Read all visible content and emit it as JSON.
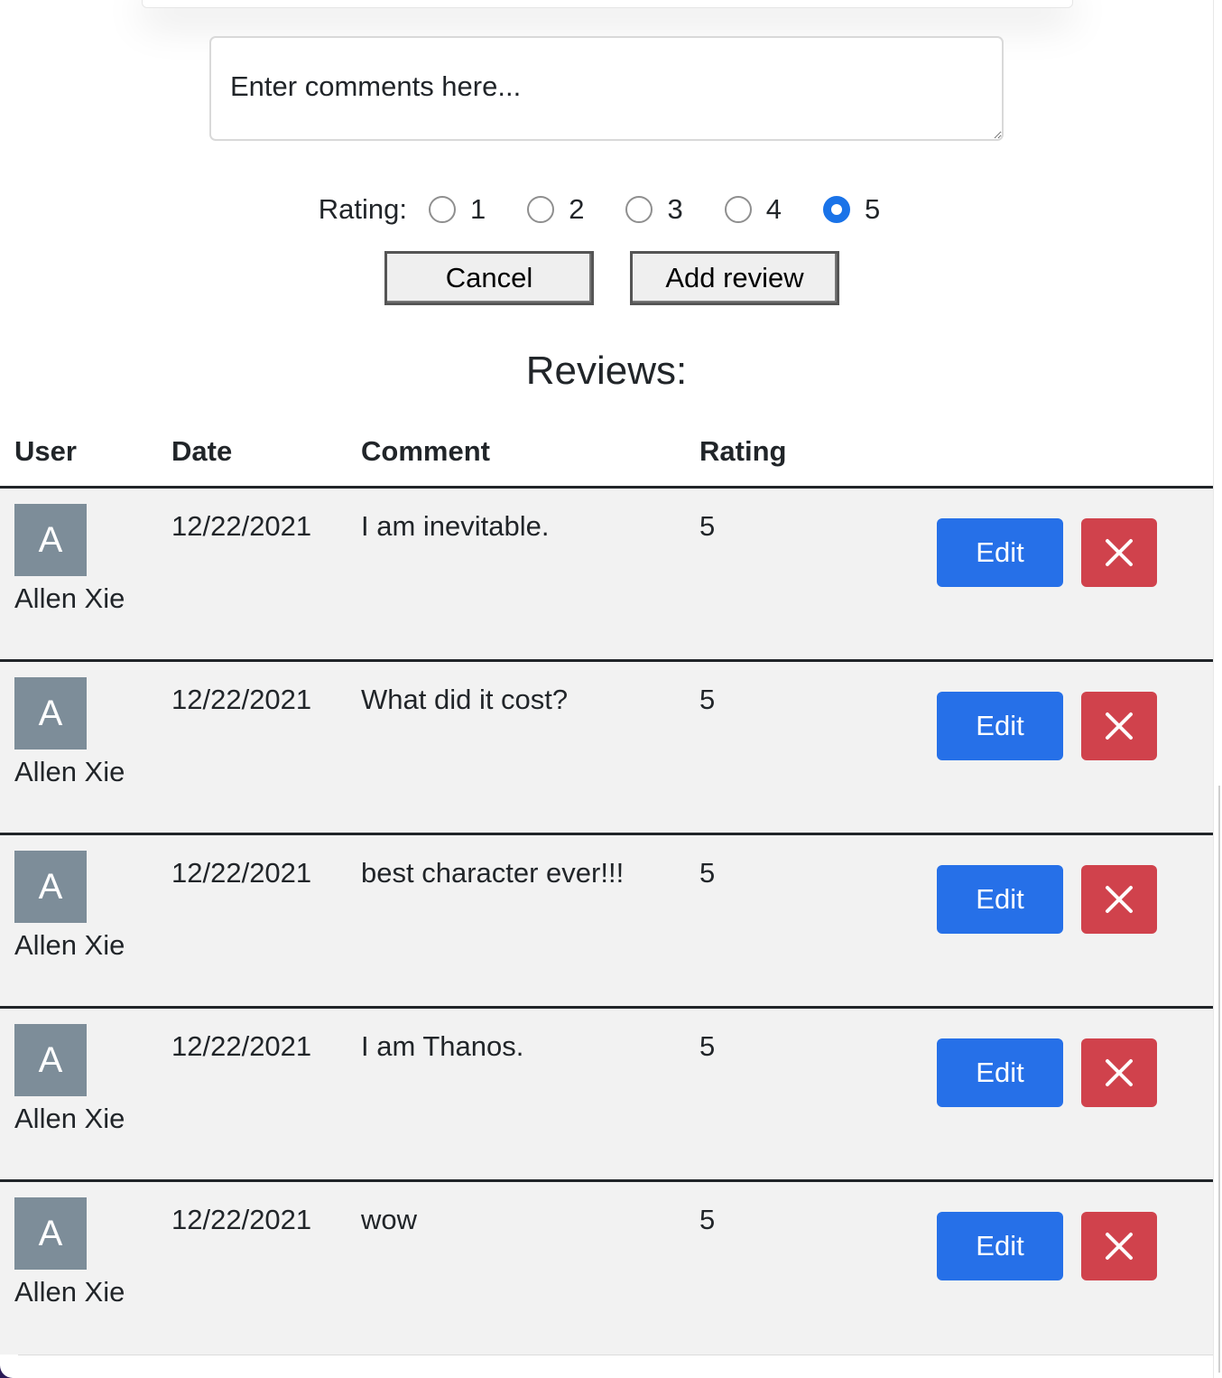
{
  "form": {
    "comment_placeholder": "Enter comments here...",
    "rating_label": "Rating:",
    "rating_options": [
      "1",
      "2",
      "3",
      "4",
      "5"
    ],
    "selected_rating": "5",
    "cancel_label": "Cancel",
    "add_label": "Add review"
  },
  "reviews": {
    "title": "Reviews:",
    "columns": {
      "user": "User",
      "date": "Date",
      "comment": "Comment",
      "rating": "Rating"
    },
    "rows": [
      {
        "avatar": "A",
        "user": "Allen Xie",
        "date": "12/22/2021",
        "comment": "I am inevitable.",
        "rating": "5",
        "edit": "Edit"
      },
      {
        "avatar": "A",
        "user": "Allen Xie",
        "date": "12/22/2021",
        "comment": "What did it cost?",
        "rating": "5",
        "edit": "Edit"
      },
      {
        "avatar": "A",
        "user": "Allen Xie",
        "date": "12/22/2021",
        "comment": "best character ever!!!",
        "rating": "5",
        "edit": "Edit"
      },
      {
        "avatar": "A",
        "user": "Allen Xie",
        "date": "12/22/2021",
        "comment": "I am Thanos.",
        "rating": "5",
        "edit": "Edit"
      },
      {
        "avatar": "A",
        "user": "Allen Xie",
        "date": "12/22/2021",
        "comment": "wow",
        "rating": "5",
        "edit": "Edit"
      }
    ]
  },
  "icons": {
    "delete": "close-icon"
  },
  "colors": {
    "edit_button": "#2670e8",
    "delete_button": "#d0424c",
    "avatar_bg": "#7d8d99",
    "row_bg": "#f2f2f2",
    "radio_checked": "#1a73e8"
  }
}
